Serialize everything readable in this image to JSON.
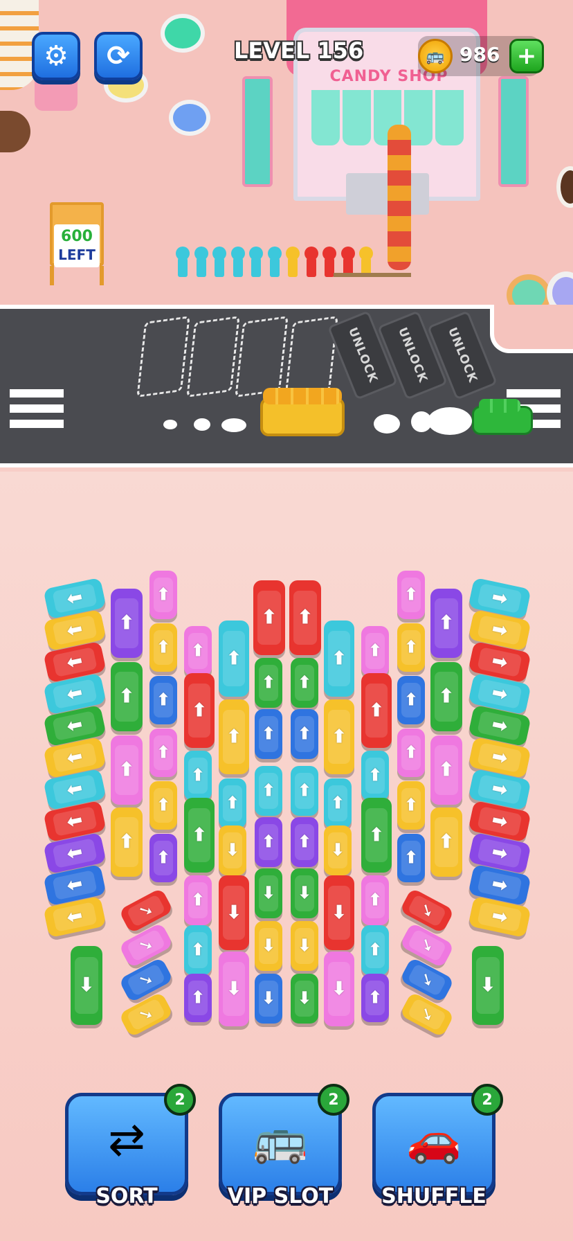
{
  "hud": {
    "level_label": "LEVEL 156",
    "coins": "986",
    "settings_icon": "gear-icon",
    "restart_icon": "restart-icon",
    "add_coins_icon": "plus-icon"
  },
  "shop": {
    "sign": "CANDY SHOP"
  },
  "remaining_sign": {
    "count": "600",
    "label": "LEFT"
  },
  "road": {
    "locked_slot_label": "UNLOCK",
    "locked_slot_count": 3,
    "open_slot_count": 4
  },
  "powerups": [
    {
      "label": "SORT",
      "count": "2",
      "icon": "sort-person-icon"
    },
    {
      "label": "VIP SLOT",
      "count": "2",
      "icon": "vip-bus-icon"
    },
    {
      "label": "SHUFFLE",
      "count": "2",
      "icon": "shuffle-car-icon"
    }
  ],
  "colors": {
    "red": "#e8342f",
    "yellow": "#f6c12a",
    "cyan": "#3cc8dc",
    "green": "#2fae3a",
    "blue": "#2f74e0",
    "purple": "#8a48e6",
    "pink": "#ef78e0"
  },
  "queue_colors": [
    "cyan",
    "cyan",
    "cyan",
    "cyan",
    "cyan",
    "cyan",
    "yellow",
    "red",
    "red",
    "red",
    "yellow"
  ],
  "vehicles": [
    {
      "c": "cyan",
      "d": "left",
      "k": "bus"
    },
    {
      "c": "yellow",
      "d": "left",
      "k": "bus"
    },
    {
      "c": "red",
      "d": "left",
      "k": "bus"
    },
    {
      "c": "cyan",
      "d": "left",
      "k": "bus"
    },
    {
      "c": "green",
      "d": "left",
      "k": "bus"
    },
    {
      "c": "yellow",
      "d": "left",
      "k": "bus"
    },
    {
      "c": "cyan",
      "d": "left",
      "k": "bus"
    },
    {
      "c": "red",
      "d": "left",
      "k": "bus"
    },
    {
      "c": "purple",
      "d": "left",
      "k": "bus"
    },
    {
      "c": "blue",
      "d": "left",
      "k": "bus"
    },
    {
      "c": "yellow",
      "d": "left",
      "k": "bus"
    },
    {
      "c": "cyan",
      "d": "right",
      "k": "bus"
    },
    {
      "c": "yellow",
      "d": "right",
      "k": "bus"
    },
    {
      "c": "red",
      "d": "right",
      "k": "bus"
    },
    {
      "c": "cyan",
      "d": "right",
      "k": "bus"
    },
    {
      "c": "green",
      "d": "right",
      "k": "bus"
    },
    {
      "c": "yellow",
      "d": "right",
      "k": "bus"
    },
    {
      "c": "cyan",
      "d": "right",
      "k": "bus"
    },
    {
      "c": "red",
      "d": "right",
      "k": "bus"
    },
    {
      "c": "purple",
      "d": "right",
      "k": "bus"
    },
    {
      "c": "blue",
      "d": "right",
      "k": "bus"
    },
    {
      "c": "yellow",
      "d": "right",
      "k": "bus"
    },
    {
      "c": "green",
      "d": "down",
      "k": "bus"
    },
    {
      "c": "green",
      "d": "down",
      "k": "bus"
    },
    {
      "c": "purple",
      "d": "up",
      "k": "bus"
    },
    {
      "c": "green",
      "d": "up",
      "k": "bus"
    },
    {
      "c": "pink",
      "d": "up",
      "k": "bus"
    },
    {
      "c": "yellow",
      "d": "up",
      "k": "bus"
    },
    {
      "c": "purple",
      "d": "up",
      "k": "bus"
    },
    {
      "c": "green",
      "d": "up",
      "k": "bus"
    },
    {
      "c": "pink",
      "d": "up",
      "k": "bus"
    },
    {
      "c": "yellow",
      "d": "up",
      "k": "bus"
    },
    {
      "c": "pink",
      "d": "up",
      "k": "car"
    },
    {
      "c": "yellow",
      "d": "up",
      "k": "car"
    },
    {
      "c": "blue",
      "d": "up",
      "k": "car"
    },
    {
      "c": "pink",
      "d": "up",
      "k": "car"
    },
    {
      "c": "yellow",
      "d": "up",
      "k": "car"
    },
    {
      "c": "purple",
      "d": "up",
      "k": "car"
    },
    {
      "c": "pink",
      "d": "up",
      "k": "car"
    },
    {
      "c": "yellow",
      "d": "up",
      "k": "car"
    },
    {
      "c": "blue",
      "d": "up",
      "k": "car"
    },
    {
      "c": "pink",
      "d": "up",
      "k": "car"
    },
    {
      "c": "yellow",
      "d": "up",
      "k": "car"
    },
    {
      "c": "blue",
      "d": "up",
      "k": "car"
    },
    {
      "c": "red",
      "d": "up",
      "k": "bus"
    },
    {
      "c": "red",
      "d": "up",
      "k": "bus"
    },
    {
      "c": "red",
      "d": "downright",
      "k": "car"
    },
    {
      "c": "pink",
      "d": "downright",
      "k": "car"
    },
    {
      "c": "blue",
      "d": "downright",
      "k": "car"
    },
    {
      "c": "yellow",
      "d": "downright",
      "k": "car"
    },
    {
      "c": "red",
      "d": "downleft",
      "k": "car"
    },
    {
      "c": "pink",
      "d": "downleft",
      "k": "car"
    },
    {
      "c": "blue",
      "d": "downleft",
      "k": "car"
    },
    {
      "c": "yellow",
      "d": "downleft",
      "k": "car"
    },
    {
      "c": "pink",
      "d": "up",
      "k": "car"
    },
    {
      "c": "red",
      "d": "up",
      "k": "bus"
    },
    {
      "c": "cyan",
      "d": "up",
      "k": "car"
    },
    {
      "c": "green",
      "d": "up",
      "k": "bus"
    },
    {
      "c": "pink",
      "d": "up",
      "k": "car"
    },
    {
      "c": "cyan",
      "d": "up",
      "k": "car"
    },
    {
      "c": "purple",
      "d": "up",
      "k": "car"
    },
    {
      "c": "cyan",
      "d": "up",
      "k": "bus"
    },
    {
      "c": "yellow",
      "d": "up",
      "k": "bus"
    },
    {
      "c": "cyan",
      "d": "up",
      "k": "car"
    },
    {
      "c": "yellow",
      "d": "down",
      "k": "car"
    },
    {
      "c": "red",
      "d": "down",
      "k": "bus"
    },
    {
      "c": "pink",
      "d": "down",
      "k": "bus"
    },
    {
      "c": "green",
      "d": "up",
      "k": "car"
    },
    {
      "c": "blue",
      "d": "up",
      "k": "car"
    },
    {
      "c": "cyan",
      "d": "up",
      "k": "car"
    },
    {
      "c": "purple",
      "d": "up",
      "k": "car"
    },
    {
      "c": "green",
      "d": "down",
      "k": "car"
    },
    {
      "c": "yellow",
      "d": "down",
      "k": "car"
    },
    {
      "c": "blue",
      "d": "down",
      "k": "car"
    },
    {
      "c": "green",
      "d": "up",
      "k": "car"
    },
    {
      "c": "blue",
      "d": "up",
      "k": "car"
    },
    {
      "c": "cyan",
      "d": "up",
      "k": "car"
    },
    {
      "c": "purple",
      "d": "up",
      "k": "car"
    },
    {
      "c": "green",
      "d": "down",
      "k": "car"
    },
    {
      "c": "yellow",
      "d": "down",
      "k": "car"
    },
    {
      "c": "green",
      "d": "down",
      "k": "car"
    },
    {
      "c": "cyan",
      "d": "up",
      "k": "bus"
    },
    {
      "c": "yellow",
      "d": "up",
      "k": "bus"
    },
    {
      "c": "cyan",
      "d": "up",
      "k": "car"
    },
    {
      "c": "yellow",
      "d": "down",
      "k": "car"
    },
    {
      "c": "red",
      "d": "down",
      "k": "bus"
    },
    {
      "c": "pink",
      "d": "down",
      "k": "bus"
    },
    {
      "c": "pink",
      "d": "up",
      "k": "car"
    },
    {
      "c": "red",
      "d": "up",
      "k": "bus"
    },
    {
      "c": "cyan",
      "d": "up",
      "k": "car"
    },
    {
      "c": "green",
      "d": "up",
      "k": "bus"
    },
    {
      "c": "pink",
      "d": "up",
      "k": "car"
    },
    {
      "c": "cyan",
      "d": "up",
      "k": "car"
    },
    {
      "c": "purple",
      "d": "up",
      "k": "car"
    }
  ]
}
